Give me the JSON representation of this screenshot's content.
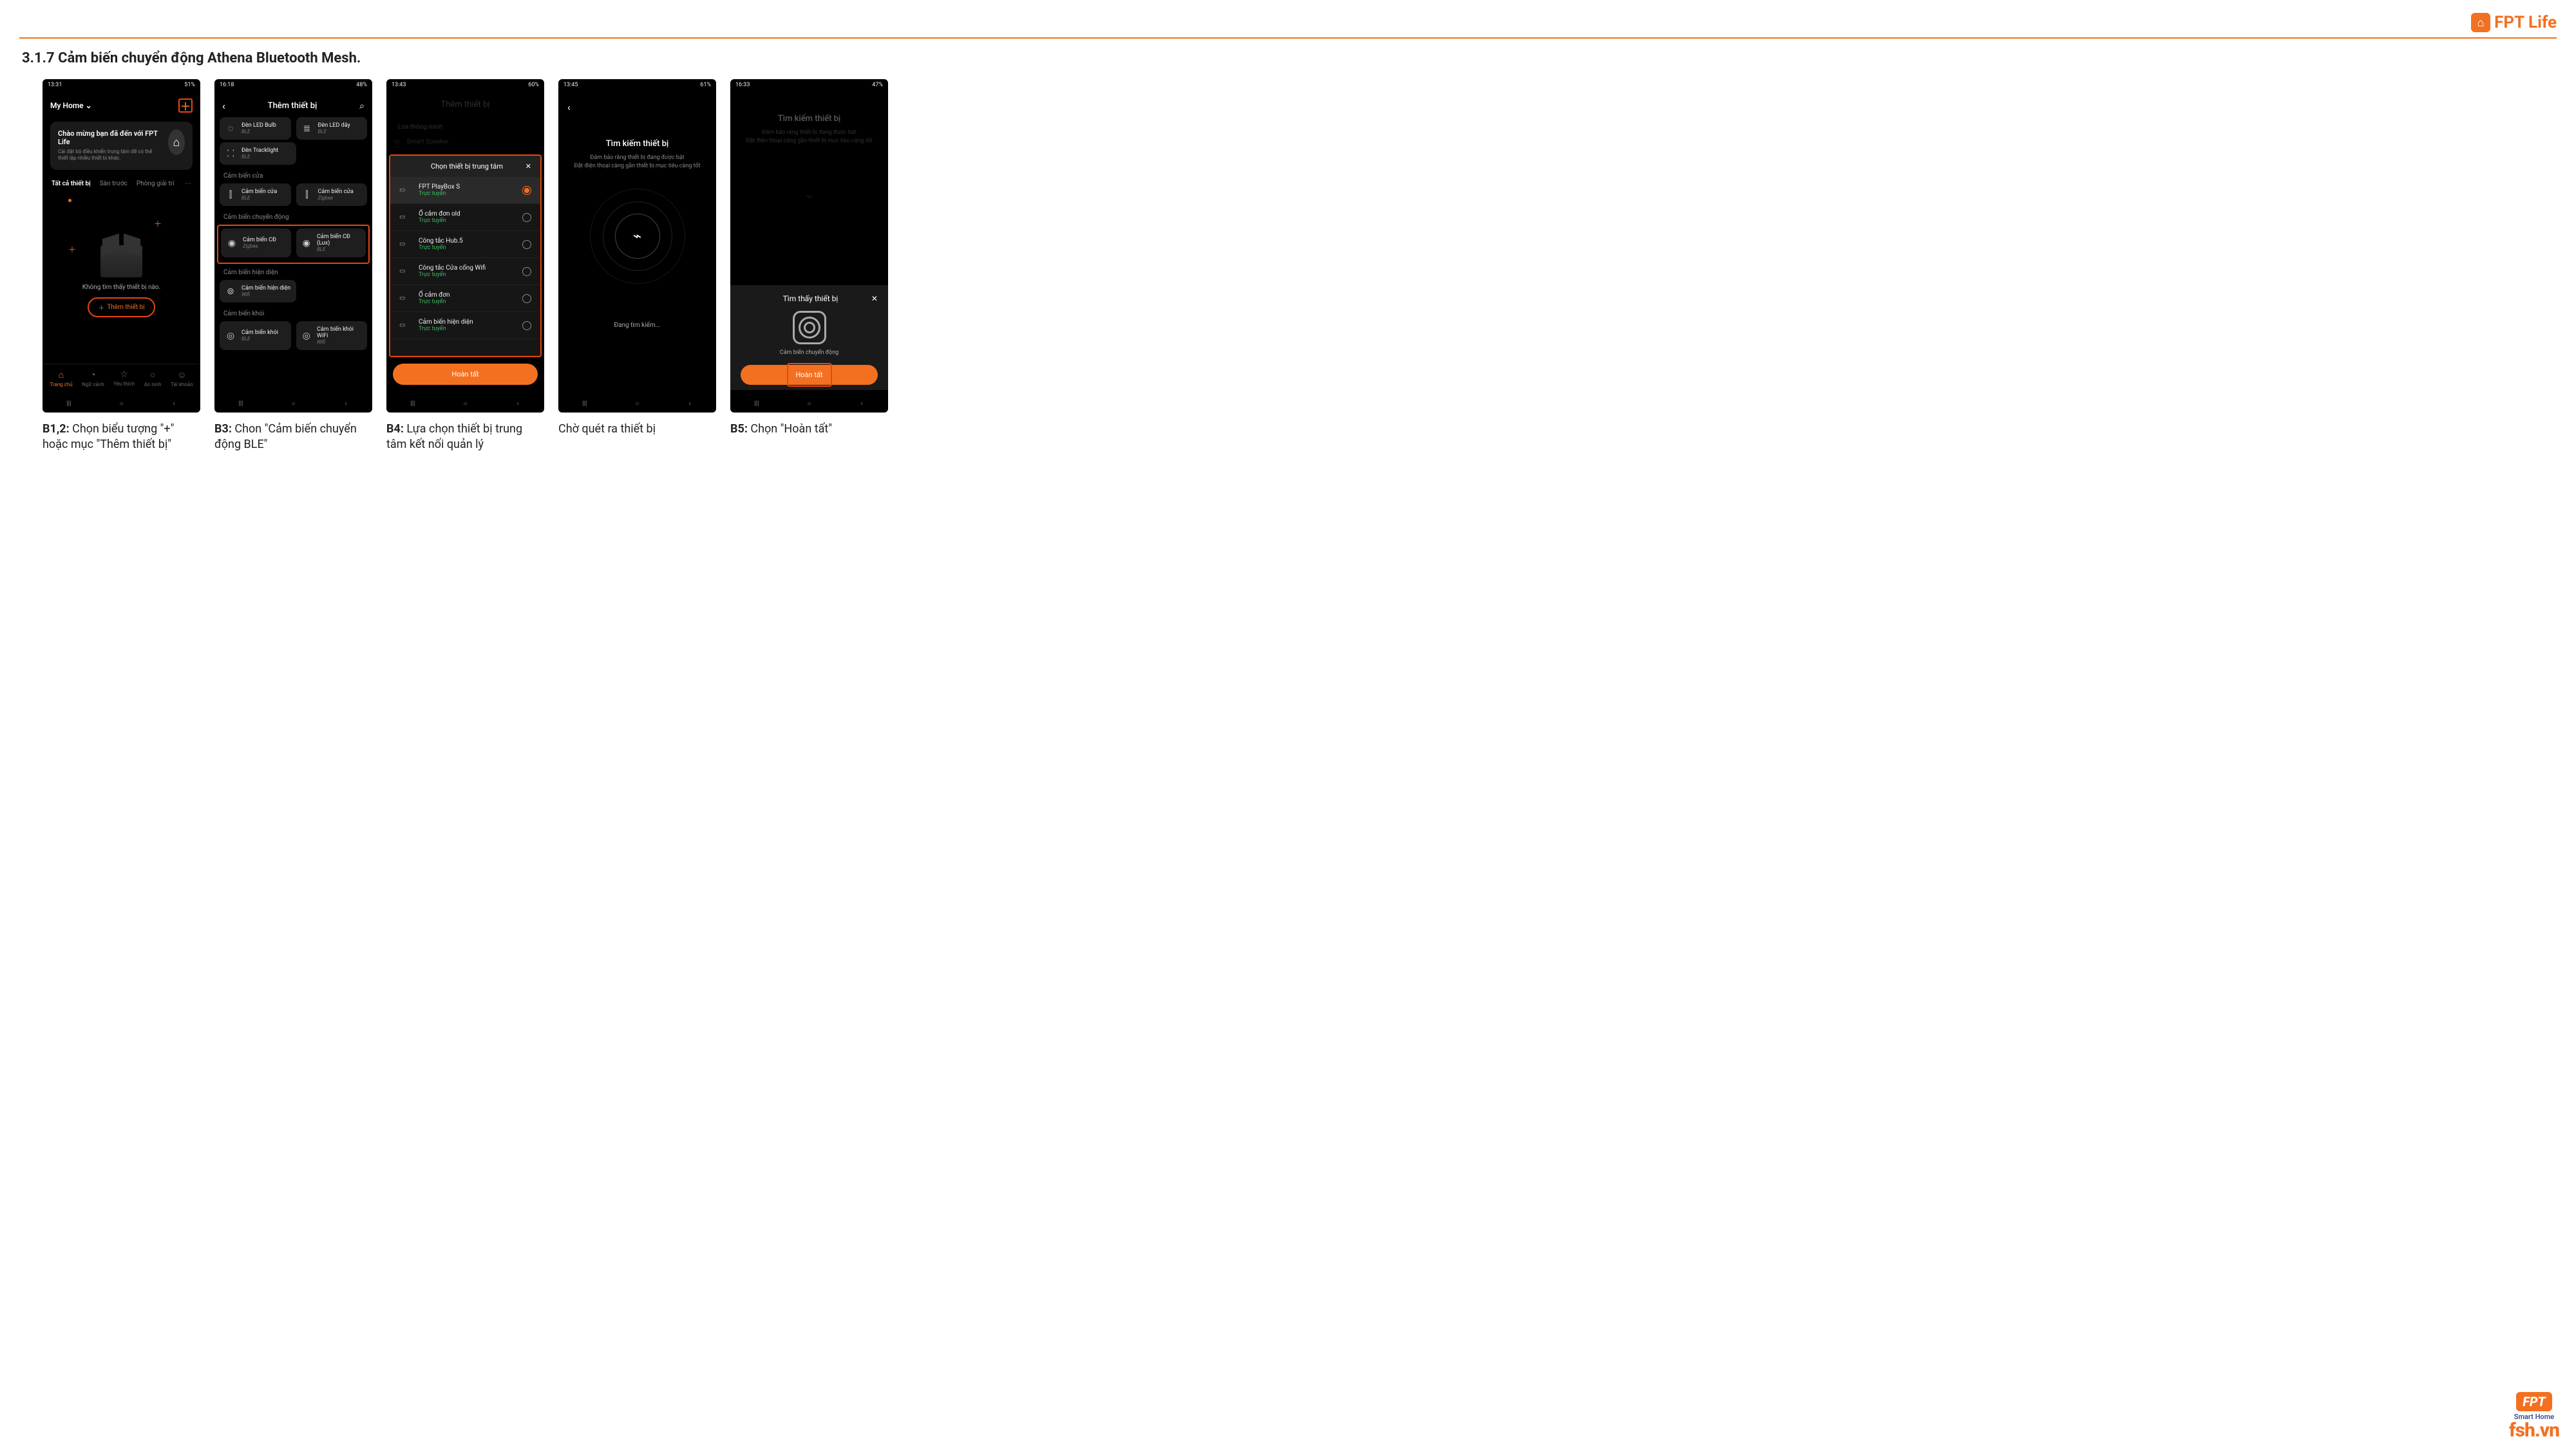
{
  "brand": {
    "name": "FPT Life",
    "footer_product": "Smart Home",
    "footer_url": "fsh.vn",
    "footer_fpt": "FPT"
  },
  "section_title": "3.1.7 Cảm biến chuyển động Athena Bluetooth Mesh.",
  "captions": {
    "c1": {
      "b": "B1,2:",
      "t": " Chọn biểu tượng \"+\" hoặc mục \"Thêm thiết bị\""
    },
    "c2": {
      "b": "B3:",
      "t": " Chon \"Cảm biến chuyển động BLE\""
    },
    "c3": {
      "b": "B4:",
      "t": " Lựa chọn thiết bị trung tâm kết nối quản lý"
    },
    "c4": {
      "b": "",
      "t": "Chờ quét ra thiết bị"
    },
    "c5": {
      "b": "B5:",
      "t": " Chọn \"Hoàn tất\""
    }
  },
  "phone1": {
    "status_time": "13:31",
    "status_right": "51%",
    "home_label": "My Home",
    "welcome_title": "Chào mừng bạn đã đến với FPT Life",
    "welcome_body": "Cài đặt bộ điều khiển trung tâm để có thể thiết lập nhiều thiết bị khác.",
    "tabs": [
      "Tất cả thiết bị",
      "Sân trước",
      "Phòng giải trí"
    ],
    "empty_msg": "Không tìm thấy thiết bị nào.",
    "add_device": "Thêm thiết bị",
    "bottom": [
      "Trang chủ",
      "Ngữ cảnh",
      "Yêu thích",
      "An ninh",
      "Tài khoản"
    ]
  },
  "phone2": {
    "status_time": "16:18",
    "status_right": "48%",
    "title": "Thêm thiết bị",
    "rows": [
      {
        "sec": "",
        "items": [
          {
            "ic": "◌",
            "n": "Đèn LED Bulb",
            "s": "BLE"
          },
          {
            "ic": "≣",
            "n": "Đèn LED dây",
            "s": "BLE"
          }
        ]
      },
      {
        "sec": "",
        "items": [
          {
            "ic": "⸬",
            "n": "Đèn Tracklight",
            "s": "BLE"
          }
        ]
      },
      {
        "sec": "Cảm biến cửa",
        "items": [
          {
            "ic": "⫿",
            "n": "Cảm biến cửa",
            "s": "BLE"
          },
          {
            "ic": "⫿",
            "n": "Cảm biến cửa",
            "s": "Zigbee"
          }
        ]
      },
      {
        "sec": "Cảm biến chuyển động",
        "hl": true,
        "items": [
          {
            "ic": "◉",
            "n": "Cảm biến CĐ",
            "s": "Zigbee"
          },
          {
            "ic": "◉",
            "n": "Cảm biến CĐ (Lux)",
            "s": "BLE"
          }
        ]
      },
      {
        "sec": "Cảm biến hiện diện",
        "items": [
          {
            "ic": "⊚",
            "n": "Cảm biến hiện diện",
            "s": "Wifi"
          }
        ]
      },
      {
        "sec": "Cảm biến khói",
        "items": [
          {
            "ic": "◎",
            "n": "Cảm biến khói",
            "s": "BLE"
          },
          {
            "ic": "◎",
            "n": "Cảm biến khói WiFi",
            "s": "Wifi"
          }
        ]
      }
    ]
  },
  "phone3": {
    "status_time": "13:43",
    "status_right": "60%",
    "dim_title": "Thêm thiết bị",
    "dim_sec": "Loa thông minh",
    "dim_item": "Smart Speaker",
    "sheet_title": "Chọn thiết bị trung tâm",
    "hubs": [
      {
        "n": "FPT PlayBox S",
        "s": "Trực tuyến",
        "sel": true
      },
      {
        "n": "Ổ cắm đơn old",
        "s": "Trực tuyến"
      },
      {
        "n": "Công tắc Hub.5",
        "s": "Trực tuyến"
      },
      {
        "n": "Công tắc Cửa cổng Wifi",
        "s": "Trực tuyến"
      },
      {
        "n": "Ổ cắm đơn",
        "s": "Trực tuyến"
      },
      {
        "n": "Cảm biến hiện diện",
        "s": "Trực tuyến"
      }
    ],
    "done": "Hoàn tất"
  },
  "phone4": {
    "status_time": "13:45",
    "status_right": "61%",
    "title": "Tìm kiếm thiết bị",
    "sub1": "Đảm bảo rằng thiết bị đang được bật",
    "sub2": "Đặt điện thoại càng gần thiết bị mục tiêu càng tốt",
    "searching": "Đang tìm kiếm..."
  },
  "phone5": {
    "status_time": "16:33",
    "status_right": "47%",
    "title": "Tìm kiếm thiết bị",
    "found": "Tìm thấy thiết bị",
    "device": "Cảm biến chuyển động",
    "done": "Hoàn tất"
  }
}
